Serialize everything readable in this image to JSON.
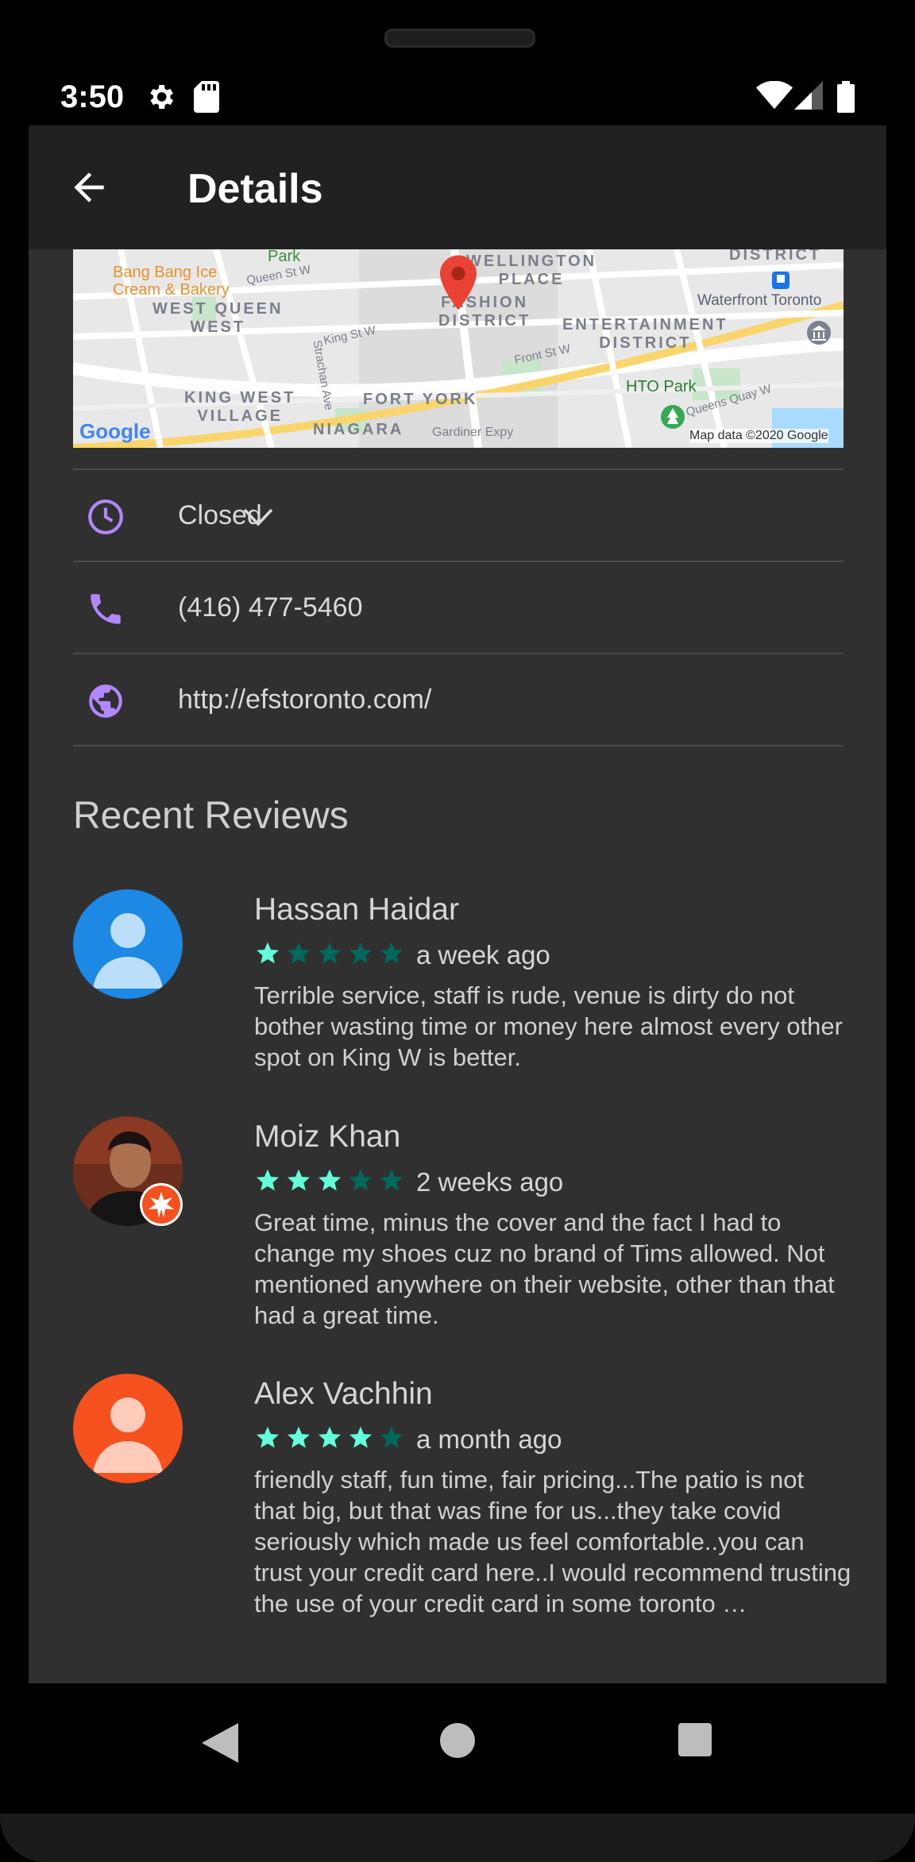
{
  "status_bar": {
    "time": "3:50",
    "icons": [
      "settings-icon",
      "sd-card-icon",
      "wifi-icon",
      "signal-icon",
      "battery-icon"
    ]
  },
  "app_bar": {
    "title": "Details",
    "back_icon": "arrow-back-icon"
  },
  "map": {
    "labels": {
      "bakery": "Bang Bang Ice\nCream & Bakery",
      "park": "Park",
      "queen_st": "Queen St W",
      "west_queen_west": "WEST QUEEN\nWEST",
      "king_st": "King St W",
      "strachan": "Strachan Ave",
      "wellington_place": "WELLINGTON\nPLACE",
      "fashion_district": "FASHION\nDISTRICT",
      "entertainment_district": "ENTERTAINMENT\nDISTRICT",
      "district": "DISTRICT",
      "waterfront": "Waterfront Toronto",
      "front_st": "Front St W",
      "king_west_village": "KING WEST\nVILLAGE",
      "fort_york": "FORT YORK",
      "niagara": "NIAGARA",
      "gardiner": "Gardiner Expy",
      "hto_park": "HTO Park",
      "queens_quay": "Queens Quay W",
      "google_logo": "Google",
      "attribution": "Map data ©2020 Google"
    }
  },
  "info": {
    "hours": "Closed",
    "phone": "(416) 477-5460",
    "website": "http://efstoronto.com/"
  },
  "colors": {
    "accent": "#b388ff",
    "star_filled": "#64ffda",
    "star_empty": "#00695c",
    "background": "#303030",
    "app_bar": "#212121"
  },
  "reviews_section": {
    "title": "Recent Reviews",
    "reviews": [
      {
        "name": "Hassan Haidar",
        "rating": 1,
        "time": "a week ago",
        "text": "Terrible service, staff is rude, venue is dirty do not bother wasting time or money here almost every other spot on King W is better.",
        "avatar_color": "#1e88e5"
      },
      {
        "name": "Moiz Khan",
        "rating": 3,
        "time": "2 weeks ago",
        "text": "Great time, minus the cover and the fact I had to change my shoes cuz no brand of Tims allowed. Not mentioned anywhere on their website, other than that had a great time.",
        "avatar_color": "#5d2a1a"
      },
      {
        "name": "Alex Vachhin",
        "rating": 4,
        "time": "a month ago",
        "text": "friendly staff, fun time, fair pricing...The patio is not that big, but that was fine for us...they take covid seriously which made us feel comfortable..you can trust your credit card here..I would recommend trusting the use of your credit card in some toronto …",
        "avatar_color": "#f4511e"
      }
    ]
  }
}
